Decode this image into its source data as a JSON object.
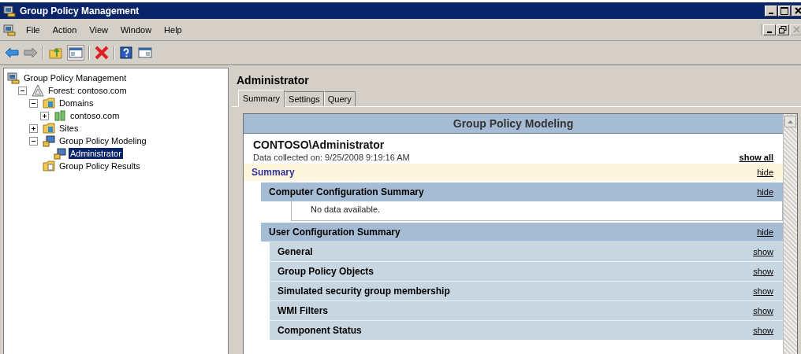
{
  "window": {
    "title": "Group Policy Management"
  },
  "menu": [
    "File",
    "Action",
    "View",
    "Window",
    "Help"
  ],
  "tree": [
    {
      "label": "Group Policy Management",
      "kind": "console",
      "selected": false,
      "children": [
        {
          "label": "Forest: contoso.com",
          "kind": "forest",
          "expanded": true,
          "selected": false,
          "children": [
            {
              "label": "Domains",
              "kind": "folder",
              "expanded": true,
              "selected": false,
              "children": [
                {
                  "label": "contoso.com",
                  "kind": "domain",
                  "expanded": false,
                  "selected": false
                }
              ]
            },
            {
              "label": "Sites",
              "kind": "folder",
              "expanded": false,
              "selected": false
            },
            {
              "label": "Group Policy Modeling",
              "kind": "modeling",
              "expanded": true,
              "selected": false,
              "children": [
                {
                  "label": "Administrator",
                  "kind": "modeling",
                  "selected": true
                }
              ]
            },
            {
              "label": "Group Policy Results",
              "kind": "results",
              "selected": false
            }
          ]
        }
      ]
    }
  ],
  "detail": {
    "title": "Administrator",
    "tabs": [
      {
        "label": "Summary",
        "selected": true
      },
      {
        "label": "Settings",
        "selected": false
      },
      {
        "label": "Query",
        "selected": false
      }
    ],
    "report": {
      "banner": "Group Policy Modeling",
      "user": "CONTOSO\\Administrator",
      "collected": "Data collected on: 9/25/2008 9:19:16 AM",
      "show_all": "show all",
      "summary": {
        "label": "Summary",
        "link": "hide"
      },
      "sections": [
        {
          "kind": "heading",
          "label": "Computer Configuration Summary",
          "link": "hide"
        },
        {
          "kind": "note",
          "label": "No data available."
        },
        {
          "kind": "heading",
          "label": "User Configuration Summary",
          "link": "hide"
        },
        {
          "kind": "sub",
          "label": "General",
          "link": "show"
        },
        {
          "kind": "sub",
          "label": "Group Policy Objects",
          "link": "show"
        },
        {
          "kind": "sub",
          "label": "Simulated security group membership",
          "link": "show"
        },
        {
          "kind": "sub",
          "label": "WMI Filters",
          "link": "show"
        },
        {
          "kind": "sub",
          "label": "Component Status",
          "link": "show"
        }
      ]
    }
  }
}
